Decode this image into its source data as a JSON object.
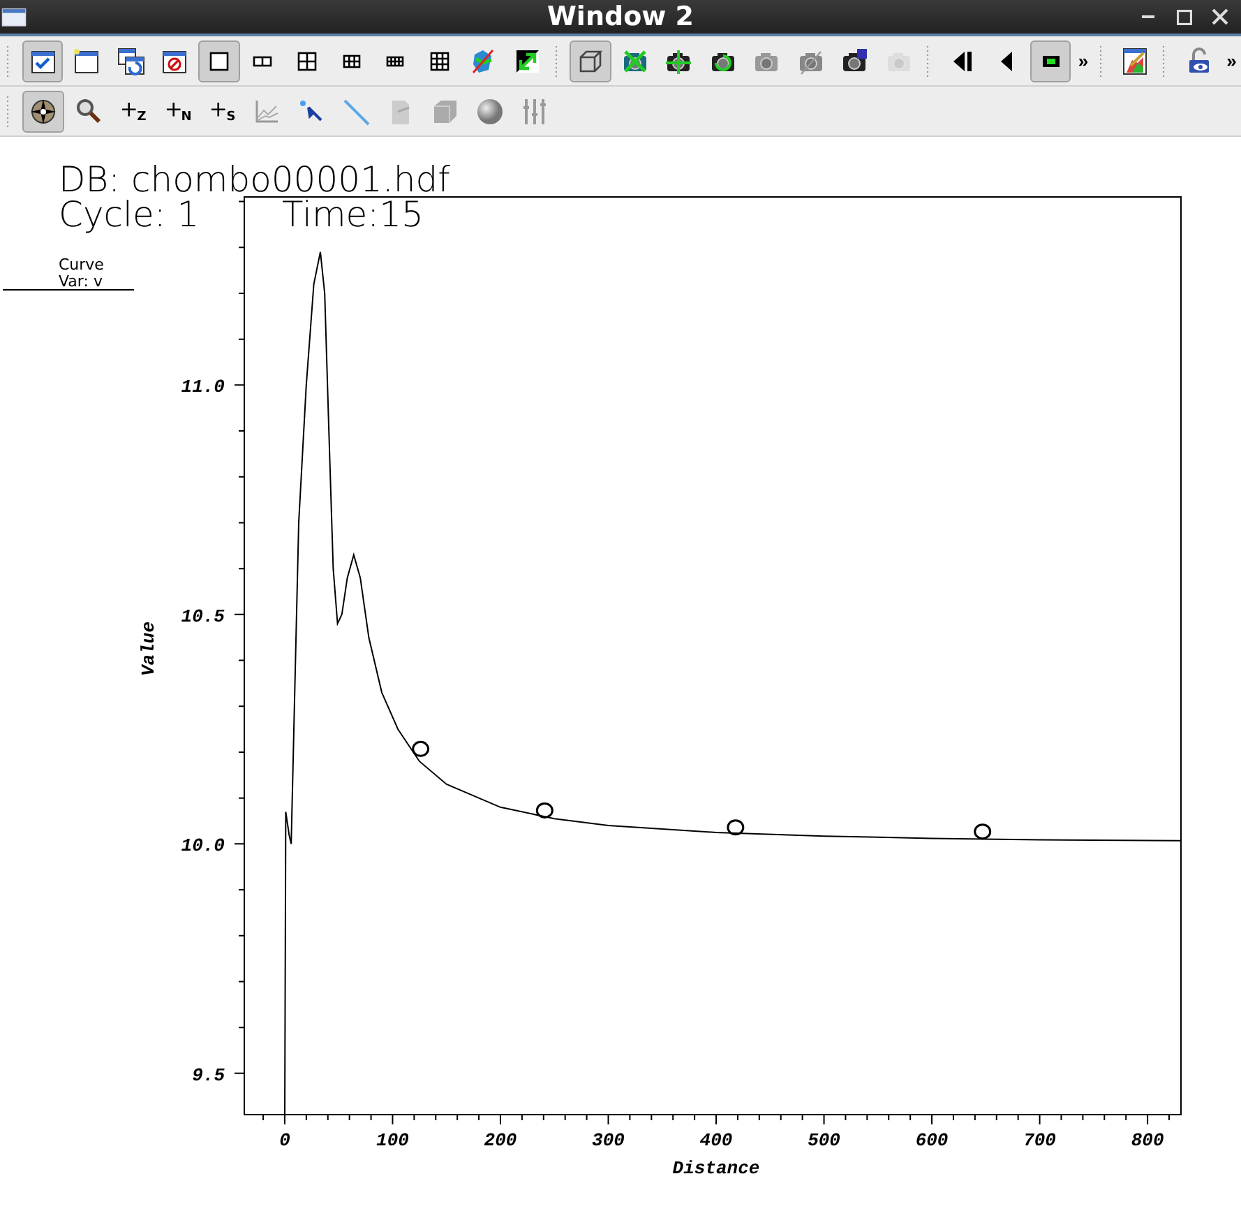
{
  "window": {
    "title": "Window 2"
  },
  "toolbar_1": [
    {
      "kind": "handle"
    },
    {
      "kind": "button",
      "selected": true,
      "disabled": false
    },
    {
      "kind": "button",
      "selected": false,
      "disabled": false
    },
    {
      "kind": "button",
      "selected": false,
      "disabled": false
    },
    {
      "kind": "button",
      "selected": false,
      "disabled": false
    },
    {
      "kind": "button",
      "selected": true,
      "disabled": false
    },
    {
      "kind": "button",
      "selected": false,
      "disabled": false
    },
    {
      "kind": "button",
      "selected": false,
      "disabled": false
    },
    {
      "kind": "button",
      "selected": false,
      "disabled": false
    },
    {
      "kind": "button",
      "selected": false,
      "disabled": false
    },
    {
      "kind": "button",
      "selected": false,
      "disabled": false
    },
    {
      "kind": "button",
      "selected": false,
      "disabled": false
    },
    {
      "kind": "button",
      "selected": false,
      "disabled": false
    },
    {
      "kind": "handle"
    },
    {
      "kind": "button",
      "selected": true,
      "disabled": false
    },
    {
      "kind": "button",
      "selected": false,
      "disabled": false
    },
    {
      "kind": "button",
      "selected": false,
      "disabled": false
    },
    {
      "kind": "button",
      "selected": false,
      "disabled": false
    },
    {
      "kind": "button",
      "selected": false,
      "disabled": false
    },
    {
      "kind": "button",
      "selected": false,
      "disabled": false
    },
    {
      "kind": "button",
      "selected": false,
      "disabled": false
    },
    {
      "kind": "button",
      "selected": false,
      "disabled": true
    },
    {
      "kind": "handle"
    },
    {
      "kind": "button",
      "selected": false,
      "disabled": false
    },
    {
      "kind": "button",
      "selected": false,
      "disabled": false
    },
    {
      "kind": "button",
      "selected": true,
      "disabled": false
    },
    {
      "kind": "more",
      "text": "»"
    },
    {
      "kind": "handle"
    },
    {
      "kind": "button",
      "selected": false,
      "disabled": false
    },
    {
      "kind": "handle"
    },
    {
      "kind": "button",
      "selected": false,
      "disabled": false
    },
    {
      "kind": "more",
      "text": "»"
    }
  ],
  "toolbar_2": [
    {
      "kind": "handle"
    },
    {
      "kind": "button",
      "selected": true
    },
    {
      "kind": "button",
      "selected": false
    },
    {
      "kind": "button",
      "selected": false,
      "text": "Z"
    },
    {
      "kind": "button",
      "selected": false,
      "text": "N"
    },
    {
      "kind": "button",
      "selected": false,
      "text": "S"
    },
    {
      "kind": "button",
      "selected": false
    },
    {
      "kind": "button",
      "selected": false
    },
    {
      "kind": "button",
      "selected": false
    },
    {
      "kind": "button",
      "selected": false
    },
    {
      "kind": "button",
      "selected": false
    },
    {
      "kind": "button",
      "selected": false
    },
    {
      "kind": "button",
      "selected": false
    }
  ],
  "plot": {
    "database": "DB: chombo00001.hdf",
    "cycle": "Cycle: 1",
    "time": "Time:15",
    "legend_title": "Curve",
    "chart_data": {
      "type": "line",
      "xlabel": "Distance",
      "ylabel": "Value",
      "xlim": [
        -37.5,
        831
      ],
      "ylim": [
        9.41,
        11.41
      ],
      "xticks": [
        0,
        100,
        200,
        300,
        400,
        500,
        600,
        700,
        800
      ],
      "yticks": [
        {
          "value": 9.5,
          "label": "9.5"
        },
        {
          "value": 10.0,
          "label": "10.0"
        },
        {
          "value": 10.5,
          "label": "10.5"
        },
        {
          "value": 11.0,
          "label": "11.0"
        }
      ],
      "series": [
        {
          "name": "Var: v",
          "type": "line",
          "color": "#000000",
          "x": [
            0,
            1,
            4,
            6,
            9,
            13,
            20,
            27,
            33,
            37,
            41,
            45,
            49,
            53,
            58,
            64,
            70,
            78,
            90,
            105,
            125,
            150,
            200,
            250,
            300,
            400,
            500,
            600,
            700,
            831
          ],
          "values": [
            9.41,
            10.07,
            10.02,
            10.0,
            10.3,
            10.7,
            11.0,
            11.22,
            11.29,
            11.2,
            10.9,
            10.6,
            10.48,
            10.5,
            10.58,
            10.63,
            10.58,
            10.45,
            10.33,
            10.25,
            10.18,
            10.13,
            10.08,
            10.055,
            10.04,
            10.025,
            10.017,
            10.012,
            10.009,
            10.007
          ]
        },
        {
          "type": "scatter",
          "color": "#000000",
          "x": [
            126,
            241,
            418,
            647
          ],
          "values": [
            10.207,
            10.073,
            10.036,
            10.027
          ]
        }
      ]
    }
  }
}
